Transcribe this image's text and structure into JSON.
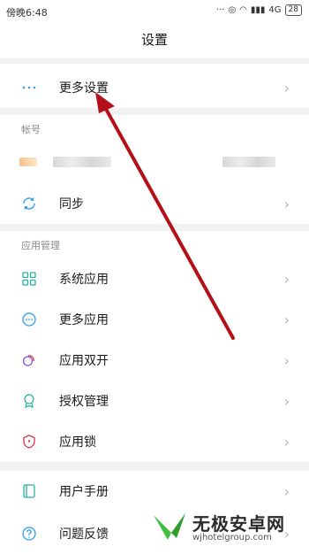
{
  "status": {
    "time": "傍晚6:48",
    "network": "4G",
    "battery": "28"
  },
  "title": "设置",
  "top_item": {
    "label": "更多设置"
  },
  "account": {
    "header": "帐号",
    "sync_label": "同步"
  },
  "apps": {
    "header": "应用管理",
    "items": [
      {
        "label": "系统应用",
        "icon": "grid-icon"
      },
      {
        "label": "更多应用",
        "icon": "more-circle-icon"
      },
      {
        "label": "应用双开",
        "icon": "dual-circle-icon"
      },
      {
        "label": "授权管理",
        "icon": "badge-icon"
      },
      {
        "label": "应用锁",
        "icon": "shield-icon"
      }
    ]
  },
  "help": {
    "items": [
      {
        "label": "用户手册",
        "icon": "book-icon"
      },
      {
        "label": "问题反馈",
        "icon": "question-icon"
      }
    ]
  },
  "watermark": {
    "title": "无极安卓网",
    "url": "wjhotelgroup.com"
  },
  "colors": {
    "accent": "#2a9df4",
    "arrow": "#b3101a",
    "teal": "#2bb3a0",
    "purple": "#8a4fd6",
    "red": "#d9344a"
  }
}
